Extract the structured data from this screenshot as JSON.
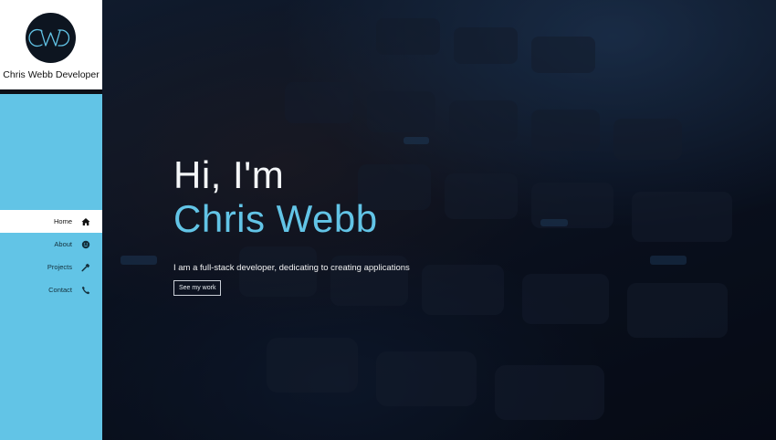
{
  "brand": {
    "logo_text": "CWD",
    "name": "Chris Webb Developer"
  },
  "nav": {
    "items": [
      {
        "label": "Home",
        "icon": "home-icon",
        "active": true
      },
      {
        "label": "About",
        "icon": "smiley-icon",
        "active": false
      },
      {
        "label": "Projects",
        "icon": "hammer-icon",
        "active": false
      },
      {
        "label": "Contact",
        "icon": "phone-icon",
        "active": false
      }
    ]
  },
  "hero": {
    "greeting": "Hi, I'm",
    "name": "Chris Webb",
    "tagline": "I am a full-stack developer, dedicating to creating applications",
    "cta_label": "See my work"
  },
  "colors": {
    "accent": "#62c4e6",
    "sidebar_bg": "#62c4e6",
    "brand_bg": "#ffffff",
    "hero_text": "#f4f6f8"
  }
}
